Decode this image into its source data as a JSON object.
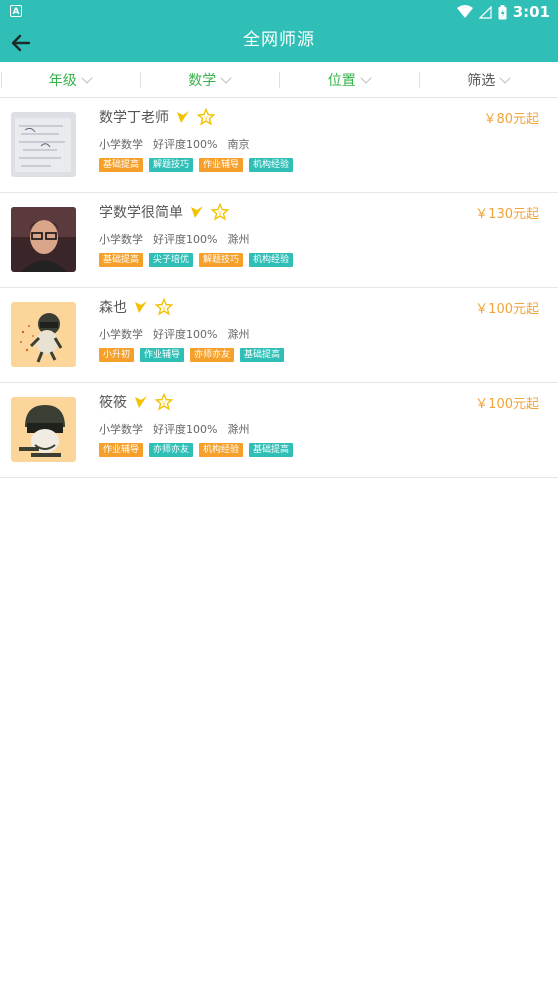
{
  "status_bar": {
    "time": "3:01"
  },
  "header": {
    "title": "全网师源"
  },
  "filters": [
    {
      "label": "年级",
      "active": true
    },
    {
      "label": "数学",
      "active": true
    },
    {
      "label": "位置",
      "active": true
    },
    {
      "label": "筛选",
      "active": false
    }
  ],
  "teachers": [
    {
      "name": "数学丁老师",
      "price": "￥80元起",
      "subject": "小学数学",
      "rating": "好评度100%",
      "city": "南京",
      "tags": [
        {
          "text": "基础提高",
          "color": "#f5a02a"
        },
        {
          "text": "解题技巧",
          "color": "#2fbfb7"
        },
        {
          "text": "作业辅导",
          "color": "#f5a02a"
        },
        {
          "text": "机构经验",
          "color": "#2fbfb7"
        }
      ]
    },
    {
      "name": "学数学很简单",
      "price": "￥130元起",
      "subject": "小学数学",
      "rating": "好评度100%",
      "city": "滁州",
      "tags": [
        {
          "text": "基础提高",
          "color": "#f5a02a"
        },
        {
          "text": "尖子培优",
          "color": "#2fbfb7"
        },
        {
          "text": "解题技巧",
          "color": "#f5a02a"
        },
        {
          "text": "机构经验",
          "color": "#2fbfb7"
        }
      ]
    },
    {
      "name": "森也",
      "price": "￥100元起",
      "subject": "小学数学",
      "rating": "好评度100%",
      "city": "滁州",
      "tags": [
        {
          "text": "小升初",
          "color": "#f5a02a"
        },
        {
          "text": "作业辅导",
          "color": "#2fbfb7"
        },
        {
          "text": "亦师亦友",
          "color": "#f5a02a"
        },
        {
          "text": "基础提高",
          "color": "#2fbfb7"
        }
      ]
    },
    {
      "name": "筱筱",
      "price": "￥100元起",
      "subject": "小学数学",
      "rating": "好评度100%",
      "city": "滁州",
      "tags": [
        {
          "text": "作业辅导",
          "color": "#f5a02a"
        },
        {
          "text": "亦师亦友",
          "color": "#2fbfb7"
        },
        {
          "text": "机构经验",
          "color": "#f5a02a"
        },
        {
          "text": "基础提高",
          "color": "#2fbfb7"
        }
      ]
    }
  ],
  "colors": {
    "primary": "#2fbfb7",
    "filter_active": "#36b24a",
    "price": "#f0a43a",
    "badge": "#f2c200"
  }
}
